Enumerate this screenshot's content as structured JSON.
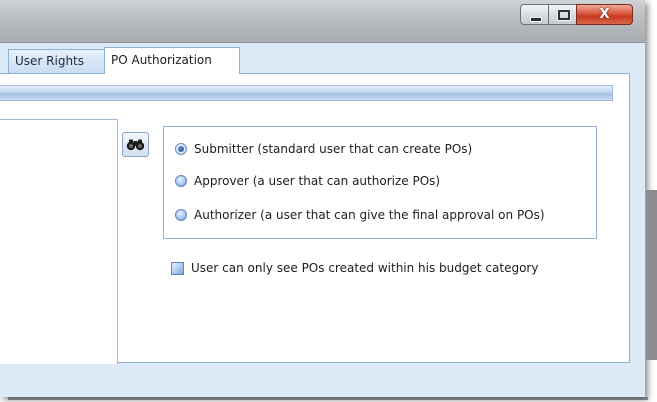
{
  "window": {
    "controls": {
      "minimize_icon": "minimize-icon",
      "maximize_icon": "maximize-icon",
      "close_icon": "close-icon",
      "close_glyph": "X"
    }
  },
  "tabs": [
    {
      "label": "User Rights",
      "active": false
    },
    {
      "label": "PO Authorization",
      "active": true
    }
  ],
  "search_button": {
    "icon": "binoculars-icon"
  },
  "roles": [
    {
      "label": "Submitter (standard user that can create POs)",
      "selected": true
    },
    {
      "label": "Approver (a user that can authorize POs)",
      "selected": false
    },
    {
      "label": "Authorizer (a user that can give the final approval on POs)",
      "selected": false
    }
  ],
  "budget_restriction": {
    "label": "User can only see POs created within his budget category",
    "checked": false
  },
  "colors": {
    "frame": "#d7e6f6",
    "tab_border": "#8eb0d3",
    "close_button": "#c7391f"
  }
}
